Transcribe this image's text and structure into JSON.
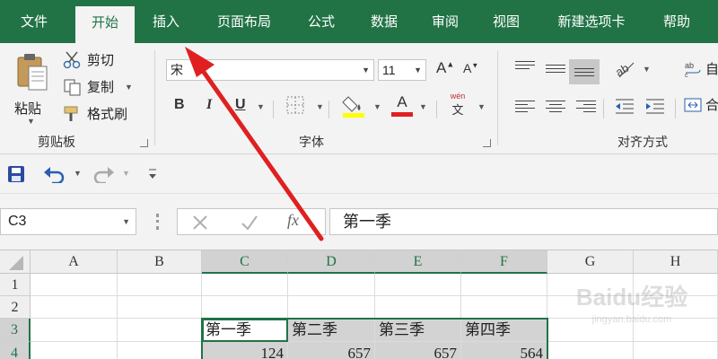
{
  "menubar": {
    "tabs": [
      {
        "label": "文件",
        "active": false
      },
      {
        "label": "开始",
        "active": true
      },
      {
        "label": "插入",
        "active": false
      },
      {
        "label": "页面布局",
        "active": false
      },
      {
        "label": "公式",
        "active": false
      },
      {
        "label": "数据",
        "active": false
      },
      {
        "label": "审阅",
        "active": false
      },
      {
        "label": "视图",
        "active": false
      },
      {
        "label": "新建选项卡",
        "active": false
      },
      {
        "label": "帮助",
        "active": false
      }
    ]
  },
  "ribbon": {
    "clipboard": {
      "paste": "粘贴",
      "cut": "剪切",
      "copy": "复制",
      "format_painter": "格式刷",
      "group": "剪贴板"
    },
    "font": {
      "font_name": "宋",
      "font_size": "11",
      "group": "字体",
      "phonetic_top": "wén",
      "phonetic_bottom": "文",
      "bold": "B",
      "italic": "I",
      "underline": "U",
      "font_color_letter": "A",
      "grow_letter": "A",
      "shrink_letter": "A"
    },
    "alignment": {
      "group": "对齐方式",
      "wrap_partial": "自",
      "merge_partial": "合"
    }
  },
  "formula_bar": {
    "name_box": "C3",
    "value": "第一季",
    "fx": "fx"
  },
  "sheet": {
    "columns": [
      "A",
      "B",
      "C",
      "D",
      "E",
      "F",
      "G",
      "H"
    ],
    "rows": [
      "1",
      "2",
      "3",
      "4"
    ],
    "cells": {
      "C3": "第一季",
      "D3": "第二季",
      "E3": "第三季",
      "F3": "第四季",
      "C4": "124",
      "D4": "657",
      "E4": "657",
      "F4": "564"
    },
    "selected_column_range": "C:F",
    "active_cell": "C3"
  },
  "colors": {
    "brand": "#217346",
    "ribbon": "#f3f3f3",
    "annotation_arrow": "#e02020"
  },
  "watermark": {
    "main": "Baidu经验",
    "sub": "jingyan.baidu.com"
  }
}
